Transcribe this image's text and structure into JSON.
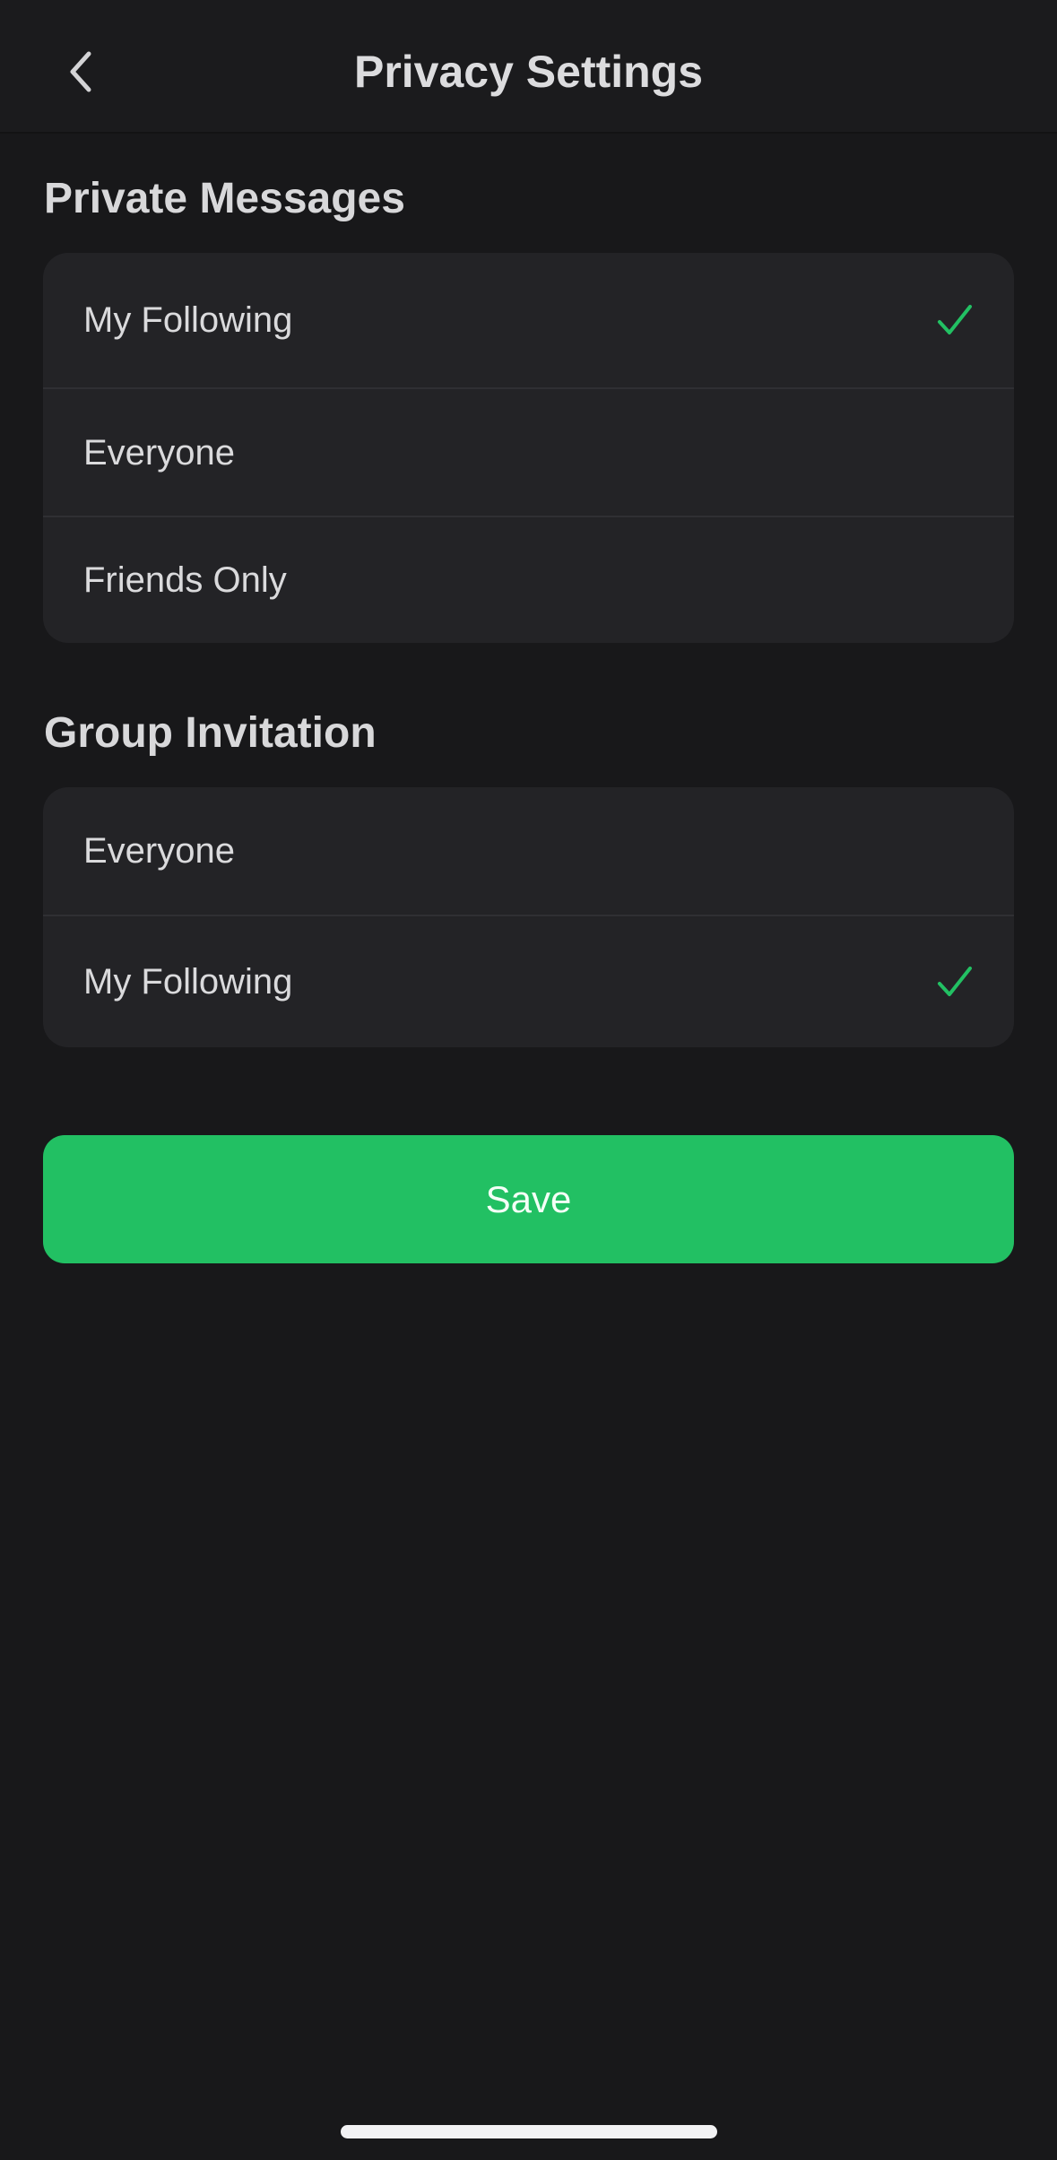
{
  "header": {
    "title": "Privacy Settings",
    "back_icon": "chevron-left-icon"
  },
  "sections": [
    {
      "title": "Private Messages",
      "options": [
        {
          "label": "My Following",
          "selected": true
        },
        {
          "label": "Everyone",
          "selected": false
        },
        {
          "label": "Friends Only",
          "selected": false
        }
      ]
    },
    {
      "title": "Group Invitation",
      "options": [
        {
          "label": "Everyone",
          "selected": false
        },
        {
          "label": "My Following",
          "selected": true
        }
      ]
    }
  ],
  "save_button": {
    "label": "Save"
  },
  "colors": {
    "background": "#18181a",
    "card": "#232326",
    "accent": "#22c063",
    "check": "#22c063"
  },
  "icons": {
    "selected": "checkmark-icon"
  }
}
